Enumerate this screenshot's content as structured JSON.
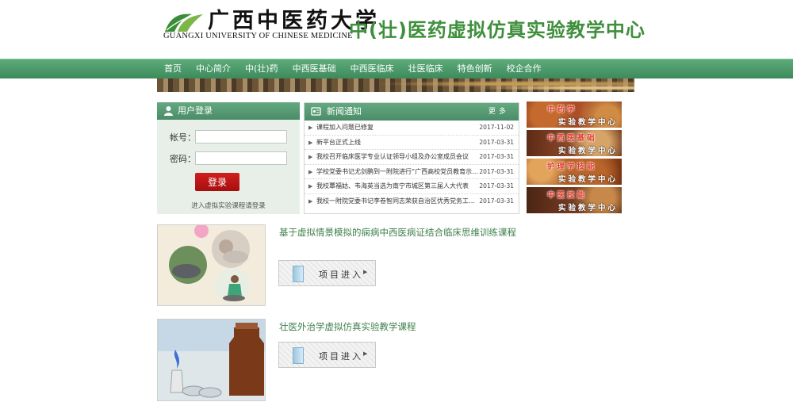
{
  "header": {
    "logo_cn": "广西中医药大学",
    "logo_en": "GUANGXI UNIVERSITY OF CHINESE MEDICINE",
    "site_title": "中(壮)医药虚拟仿真实验教学中心"
  },
  "nav": {
    "items": [
      "首页",
      "中心简介",
      "中(壮)药",
      "中西医基础",
      "中西医临床",
      "壮医临床",
      "特色创新",
      "校企合作"
    ]
  },
  "login": {
    "title": "用户登录",
    "account_label": "帐号：",
    "password_label": "密码：",
    "account_value": "",
    "password_value": "",
    "button": "登录",
    "hint": "进入虚拟实验课程请登录"
  },
  "news": {
    "title": "新闻通知",
    "more": "更多",
    "items": [
      {
        "title": "课程加入问题已修复",
        "date": "2017-11-02"
      },
      {
        "title": "新平台正式上线",
        "date": "2017-03-31"
      },
      {
        "title": "我校召开临床医学专业认证领导小组及办公室成员会议",
        "date": "2017-03-31"
      },
      {
        "title": "学校党委书记尤剑鹏到一附院进行“广西高校党员教育示范…",
        "date": "2017-03-31"
      },
      {
        "title": "我校覃福姑、韦海英当选为南宁市城区第三届人大代表",
        "date": "2017-03-31"
      },
      {
        "title": "我校一附院党委书记李卷智同志荣获自治区优秀党务工作者",
        "date": "2017-03-31"
      }
    ]
  },
  "side_banners": [
    {
      "line1": "中药学",
      "line2": "实验教学中心"
    },
    {
      "line1": "中西医基础",
      "line2": "实验教学中心"
    },
    {
      "line1": "护理学技能",
      "line2": "实验教学中心"
    },
    {
      "line1": "中医技能",
      "line2": "实验教学中心"
    }
  ],
  "courses": [
    {
      "title": "基于虚拟情景模拟的痫病中西医病证结合临床思维训练课程",
      "button": "项目进入"
    },
    {
      "title": "壮医外治学虚拟仿真实验教学课程",
      "button": "项目进入"
    }
  ],
  "colors": {
    "brand_green": "#3f8f3c",
    "nav_green": "#4e9a6b",
    "button_red": "#b81414"
  }
}
